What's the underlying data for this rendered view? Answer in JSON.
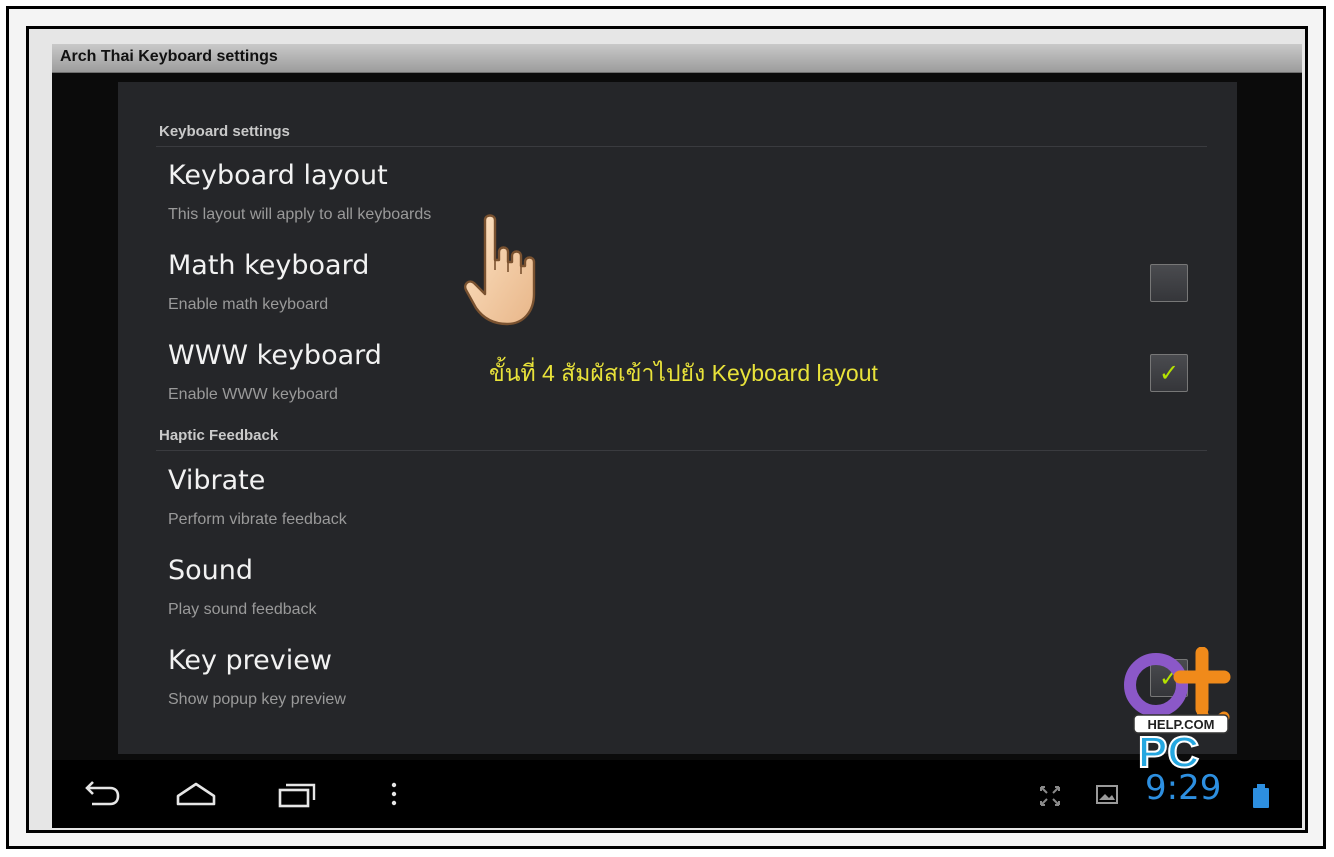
{
  "window": {
    "title": "Arch Thai Keyboard settings"
  },
  "sections": [
    {
      "header": "Keyboard settings"
    },
    {
      "header": "Haptic Feedback"
    }
  ],
  "items": [
    {
      "title": "Keyboard layout",
      "subtitle": "This layout will apply to all keyboards",
      "checkbox": null
    },
    {
      "title": "Math keyboard",
      "subtitle": "Enable math keyboard",
      "checkbox": false
    },
    {
      "title": "WWW keyboard",
      "subtitle": "Enable WWW keyboard",
      "checkbox": true
    },
    {
      "title": "Vibrate",
      "subtitle": "Perform vibrate feedback",
      "checkbox": null
    },
    {
      "title": "Sound",
      "subtitle": "Play sound feedback",
      "checkbox": null
    },
    {
      "title": "Key preview",
      "subtitle": "Show popup key preview",
      "checkbox": true
    }
  ],
  "annotation": {
    "text": "ขั้นที่ 4 สัมผัสเข้าไปยัง Keyboard layout"
  },
  "status_bar": {
    "clock": "9:29"
  },
  "nav_icons": [
    "back-icon",
    "home-icon",
    "recent-apps-icon",
    "menu-icon"
  ],
  "status_icons": [
    "fullscreen-icon",
    "gallery-icon",
    "battery-icon"
  ],
  "logo": {
    "text": "HELP.COM",
    "letters": "PC"
  },
  "colors": {
    "accent_check": "#b4e200",
    "annotation": "#e8e23a",
    "clock": "#2d8fe0"
  }
}
